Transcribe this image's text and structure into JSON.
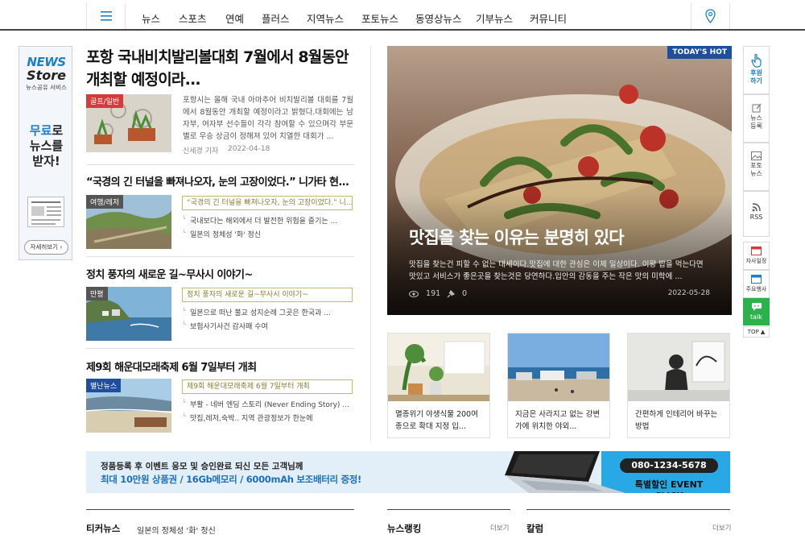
{
  "nav": {
    "items": [
      "뉴스",
      "스포츠",
      "연예",
      "플러스",
      "지역뉴스",
      "포토뉴스",
      "동영상뉴스",
      "기부뉴스",
      "커뮤니티"
    ]
  },
  "side_ad": {
    "brand1": "NEWS",
    "brand2": "Store",
    "sub": "뉴스공유 서비스",
    "line1_blue": "무료",
    "line1_rest": "로",
    "line2": "뉴스를",
    "line3": "받자!",
    "button": "자세히보기"
  },
  "lead": {
    "title": "포항 국내비치발리볼대회 7월에서 8월동안 개최할 예정이라...",
    "badge": "골프/일반",
    "body": "포항시는 올해 국내 아마추어 비치발리볼 대회를 7월에서 8월동안 개최할 예정이라고 밝혔다.대회에는 남자부, 여자부 선수들이 각각 참여할 수 있으며각 부문별로 우승 상금이 정해져 있어 치열한 대회가 ...",
    "author": "신세경 기자",
    "date": "2022-04-18"
  },
  "sections": [
    {
      "title": "“국경의 긴 터널을 빠져나오자, 눈의 고장이었다.” 니가타 현...",
      "badge": "여행/레저",
      "boxed": "“국경의 긴 터널을 빠져나오자, 눈의 고장이었다.” 니...",
      "subs": [
        "국내보다는 해외에서 더 발전한 위험을 즐기는 ...",
        "일본의 정체성 '화' 정신"
      ]
    },
    {
      "title": "정치 풍자의 새로운 길~무사시 이야기~",
      "badge": "만평",
      "boxed": "정치 풍자의 새로운 길~무사시 이야기~",
      "subs": [
        "일본으로 떠난 불교 성지순례 그곳은 한국과 ...",
        "보험사기사건 감사패 수여"
      ]
    },
    {
      "title": "제9회 해운대모래축제 6월 7일부터 개최",
      "badge": "별난뉴스",
      "boxed": "제9회 해운대모래축제 6월 7일부터 개최",
      "subs": [
        "부활 - 네버 엔딩 스토리 (Never Ending Story) ...",
        "맛집,레저,숙박.. 지역 관광정보가 한눈에"
      ]
    }
  ],
  "hero": {
    "badge": "TODAY'S HOT",
    "title": "맛집을 찾는 이유는 분명히 있다",
    "body": "맛집을 찾는건 피할 수 없는 대세이다.맛집에 대한 관심은 이제 일상이다. 이왕 밥을 먹는다면 맛있고 서비스가 좋은곳을 찾는것은 당연하다.입안의 감동을 주는 작은 맛의 미학에 ...",
    "views": "191",
    "pins": "0",
    "date": "2022-05-28"
  },
  "cards": [
    {
      "text": "멸종위기 야생식물 200여종으로 확대 지정 입..."
    },
    {
      "text": "지금은 사라지고 없는 강변가에 위치한 야외..."
    },
    {
      "text": "간편하게 인테리어 바꾸는 방법"
    }
  ],
  "right_sidebar": {
    "donate": "후원\n하기",
    "submit": "뉴스\n등록",
    "photo": "포토\n뉴스",
    "rss": "RSS",
    "schedule": "자사일정",
    "events": "주요행사",
    "talk": "talk",
    "top": "TOP ▲"
  },
  "banner": {
    "line1": "정품등록 후 이벤트 응모 및 승인완료 되신 모든 고객님께",
    "line2": "최대 10만원 상품권 / 16Gb메모리 / 6000mAh 보조배터리 증정!",
    "phone": "080-1234-5678",
    "event": "특별할인 EVENT CLICK"
  },
  "bottom": {
    "ticker_title": "티커뉴스",
    "ticker_text": "일본의 정체성 '화' 정신",
    "ranking_title": "뉴스랭킹",
    "ranking_more": "더보기",
    "column_title": "칼럼",
    "column_more": "더보기"
  },
  "colors": {
    "accent_blue": "#1f4e9c",
    "link_blue": "#1d7fc4",
    "badge_red": "#d63a3a",
    "badge_dark": "#555555",
    "box_gold": "#c8b76d",
    "talk_green": "#2bb24c",
    "banner_cyan": "#28a8e4"
  }
}
